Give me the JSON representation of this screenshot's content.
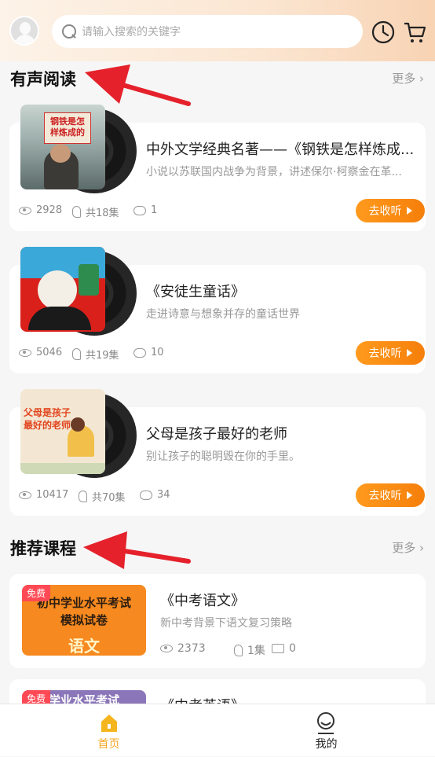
{
  "header": {
    "search_placeholder": "请输入搜索的关键字"
  },
  "sections": {
    "audio": {
      "title": "有声阅读",
      "more": "更多"
    },
    "courses": {
      "title": "推荐课程",
      "more": "更多"
    }
  },
  "audio_items": [
    {
      "title": "中外文学经典名著——《钢铁是怎样炼成...",
      "subtitle": "小说以苏联国内战争为背景，讲述保尔·柯察金在革...",
      "views": "2928",
      "episodes": "共18集",
      "comments": "1",
      "button": "去收听",
      "cover_text": "钢铁是怎样炼成的"
    },
    {
      "title": "《安徒生童话》",
      "subtitle": "走进诗意与想象并存的童话世界",
      "views": "5046",
      "episodes": "共19集",
      "comments": "10",
      "button": "去收听"
    },
    {
      "title": "父母是孩子最好的老师",
      "subtitle": "别让孩子的聪明毁在你的手里。",
      "views": "10417",
      "episodes": "共70集",
      "comments": "34",
      "button": "去收听",
      "cover_text": "父母是孩子最好的老师"
    }
  ],
  "course_items": [
    {
      "badge": "免费",
      "title": "《中考语文》",
      "subtitle": "新中考背景下语文复习策略",
      "views": "2373",
      "episodes": "1集",
      "comments": "0",
      "cover_line1": "初中学业水平考试",
      "cover_line2": "模拟试卷",
      "cover_subject": "语文"
    },
    {
      "badge": "免费",
      "title": "《中考英语》",
      "cover_line1": "学业水平考试"
    }
  ],
  "tabbar": {
    "home": "首页",
    "mine": "我的",
    "active_color": "#f5a623"
  },
  "colors": {
    "accent": "#f57f0a",
    "badge": "#ff4a55",
    "arrow": "#e5212b"
  }
}
